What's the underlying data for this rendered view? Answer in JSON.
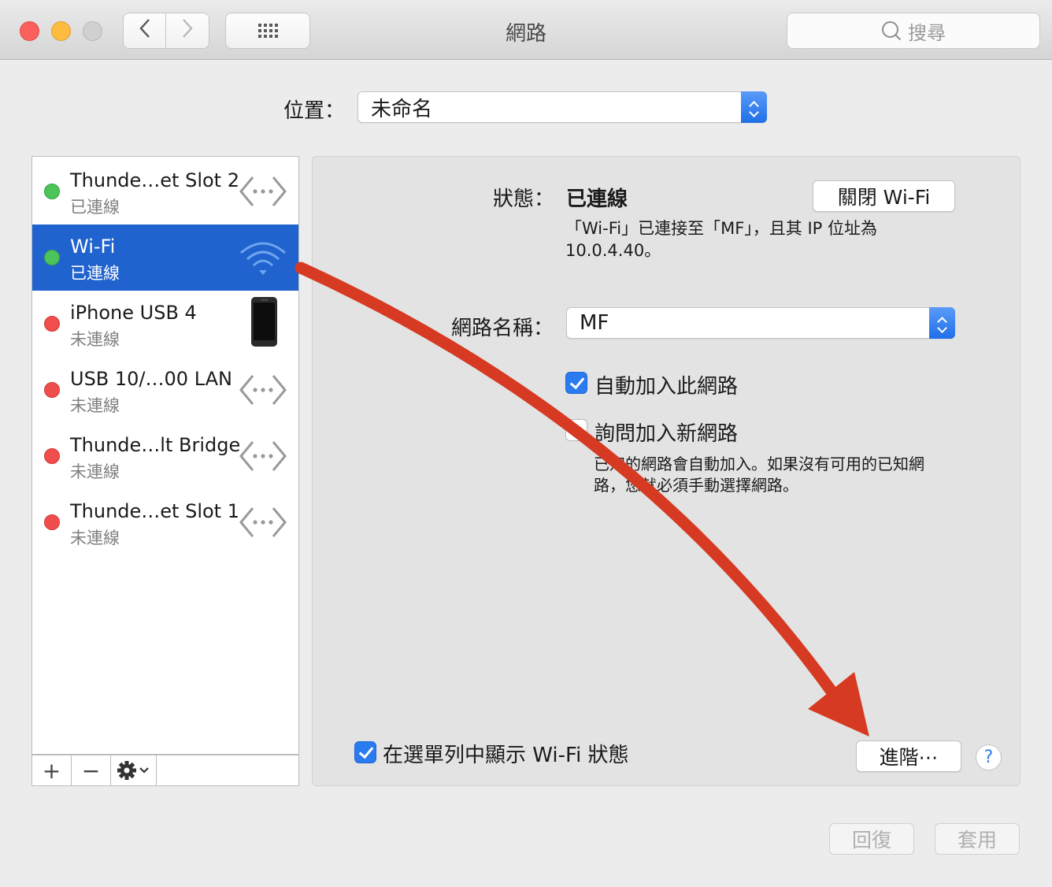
{
  "window": {
    "title": "網路",
    "search_placeholder": "搜尋"
  },
  "location": {
    "label": "位置：",
    "value": "未命名"
  },
  "services": [
    {
      "name": "Thunde…et Slot 2",
      "status": "已連線",
      "connected": true,
      "icon": "ethernet-icon"
    },
    {
      "name": "Wi-Fi",
      "status": "已連線",
      "connected": true,
      "icon": "wifi-icon",
      "selected": true
    },
    {
      "name": "iPhone USB 4",
      "status": "未連線",
      "connected": false,
      "icon": "iphone-icon"
    },
    {
      "name": "USB 10/…00 LAN",
      "status": "未連線",
      "connected": false,
      "icon": "ethernet-icon"
    },
    {
      "name": "Thunde…lt Bridge",
      "status": "未連線",
      "connected": false,
      "icon": "ethernet-icon"
    },
    {
      "name": "Thunde…et Slot 1",
      "status": "未連線",
      "connected": false,
      "icon": "ethernet-icon"
    }
  ],
  "toolbar": {
    "add": "+",
    "remove": "−"
  },
  "detail": {
    "status_label": "狀態：",
    "status_value": "已連線",
    "turn_off_button": "關閉 Wi-Fi",
    "status_desc_line1": "「Wi-Fi」已連接至「MF」，且其 IP 位址為",
    "status_desc_line2": "10.0.4.40。",
    "network_name_label": "網路名稱：",
    "network_name_value": "MF",
    "auto_join_label": "自動加入此網路",
    "auto_join_checked": true,
    "ask_join_label": "詢問加入新網路",
    "ask_join_checked": false,
    "ask_join_desc_line1": "已知的網路會自動加入。如果沒有可用的已知網",
    "ask_join_desc_line2": "路，您就必須手動選擇網路。",
    "show_menu_label": "在選單列中顯示 Wi-Fi 狀態",
    "show_menu_checked": true,
    "advanced_button": "進階⋯",
    "help": "?"
  },
  "footer": {
    "revert_button": "回復",
    "apply_button": "套用"
  },
  "colors": {
    "selection": "#2063cf",
    "accent": "#2a7bf0",
    "connected": "#4cc45a",
    "disconnected": "#f04d4d",
    "annotation_arrow": "#d63a22"
  }
}
